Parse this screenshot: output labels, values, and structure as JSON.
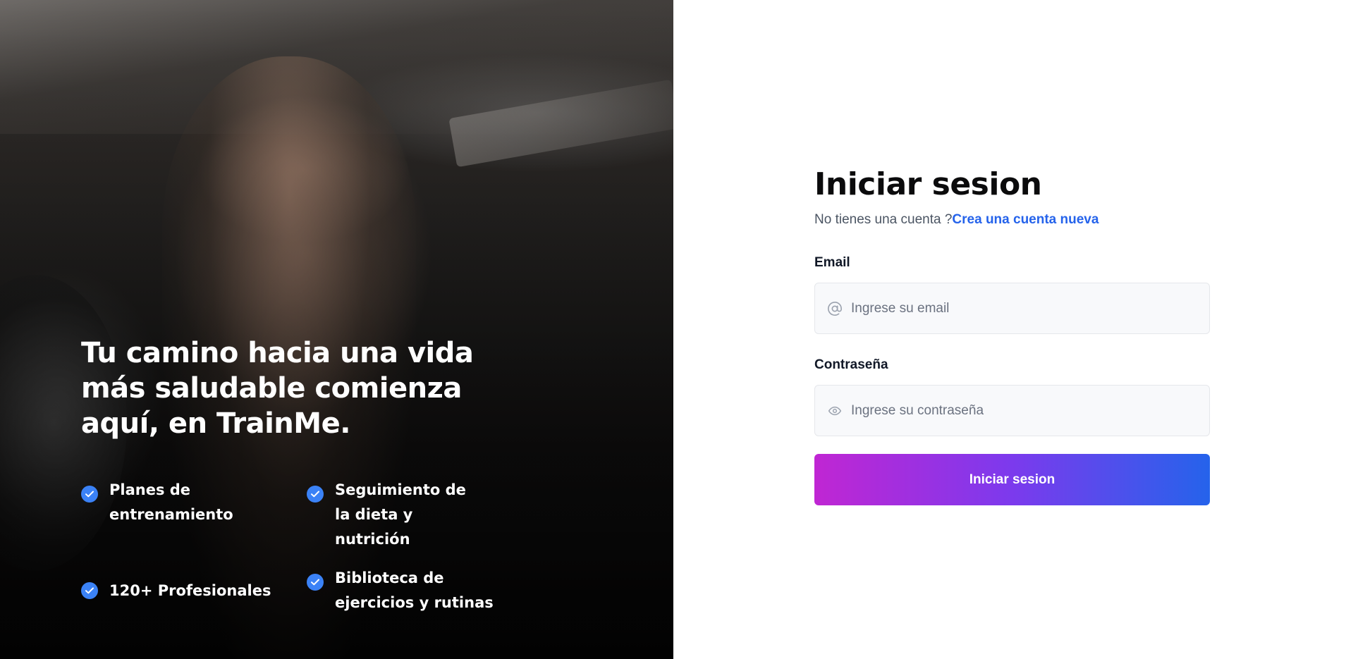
{
  "hero": {
    "headline": "Tu camino hacia una vida más saludable comienza aquí, en TrainMe.",
    "features": [
      {
        "label": "Planes de entrenamiento"
      },
      {
        "label": "Seguimiento de la dieta y nutrición"
      },
      {
        "label": "120+ Profesionales"
      },
      {
        "label": "Biblioteca de ejercicios y rutinas"
      }
    ],
    "check_color": "#3b82f6",
    "check_icon": "check-circle-icon"
  },
  "login": {
    "title": "Iniciar sesion",
    "no_account_text": "No tienes una cuenta ?",
    "create_account_link": "Crea una cuenta nueva",
    "email_label": "Email",
    "email_placeholder": "Ingrese su email",
    "email_value": "",
    "email_icon": "at-sign-icon",
    "password_label": "Contraseña",
    "password_placeholder": "Ingrese su contraseña",
    "password_value": "",
    "password_icon": "eye-icon",
    "submit_label": "Iniciar sesion"
  },
  "colors": {
    "link": "#2563eb",
    "button_gradient_start": "#c026d3",
    "button_gradient_end": "#2563eb",
    "input_bg": "#f8f9fb"
  }
}
